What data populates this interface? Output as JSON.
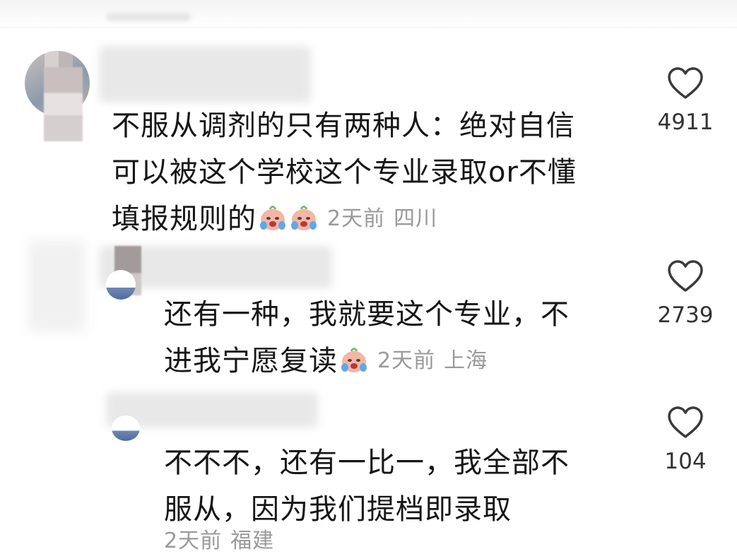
{
  "comments": [
    {
      "text_lines": [
        "不服从调剂的只有两种人：绝对自信",
        "可以被这个学校这个专业录取or不懂",
        "填报规则的"
      ],
      "emoji_count": 2,
      "time": "2天前",
      "location": "四川",
      "likes": "4911"
    },
    {
      "text_lines": [
        "还有一种，我就要这个专业，不",
        "进我宁愿复读"
      ],
      "emoji_count": 1,
      "time": "2天前",
      "location": "上海",
      "likes": "2739"
    },
    {
      "text_lines": [
        "不不不，还有一比一，我全部不",
        "服从，因为我们提档即录取"
      ],
      "emoji_count": 0,
      "time": "2天前",
      "location": "福建",
      "likes": "104"
    }
  ],
  "icons": {
    "like": "heart-outline-icon",
    "emoji": "crying-face-emoji"
  },
  "colors": {
    "text": "#161616",
    "meta": "#9a9a9a",
    "icon": "#3a3a3a"
  }
}
